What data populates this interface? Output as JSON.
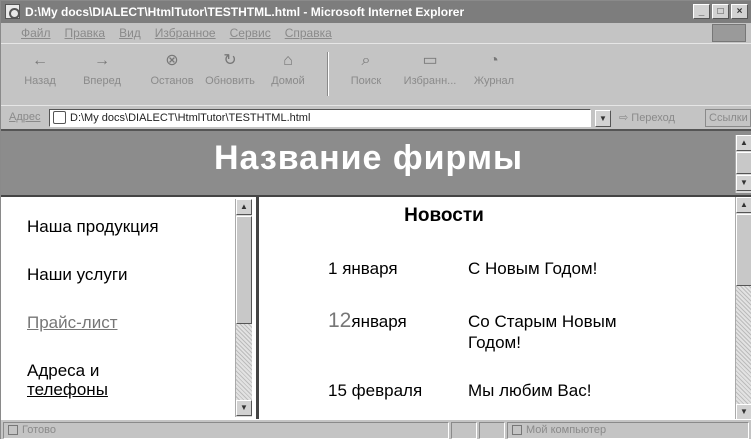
{
  "window": {
    "title": "D:\\My docs\\DIALECT\\HtmlTutor\\TESTHTML.html - Microsoft Internet Explorer",
    "controls": [
      "_",
      "□",
      "×"
    ]
  },
  "menu": [
    "Файл",
    "Правка",
    "Вид",
    "Избранное",
    "Сервис",
    "Справка"
  ],
  "toolbar": {
    "back": "Назад",
    "forward": "Вперед",
    "stop": "Останов",
    "refresh": "Обновить",
    "home": "Домой",
    "search": "Поиск",
    "favorites": "Избранн...",
    "history": "Журнал"
  },
  "address": {
    "label": "Адрес",
    "value": "D:\\My docs\\DIALECT\\HtmlTutor\\TESTHTML.html",
    "go": "Переход",
    "links": "Ссылки"
  },
  "page": {
    "firm_title": "Название фирмы",
    "nav": {
      "products": "Наша продукция",
      "services": "Наши услуги",
      "price": "Прайс-лист",
      "addresses_line1": "Адреса и",
      "addresses_line2": "телефоны"
    },
    "news": {
      "title": "Новости",
      "items": [
        {
          "day": "1",
          "month": "января",
          "text": "С Новым Годом!"
        },
        {
          "day": "12",
          "month": "января",
          "text": "Со Старым Новым Годом!"
        },
        {
          "day": "15",
          "month": "февраля",
          "text": "Мы любим Вас!"
        }
      ]
    }
  },
  "status": {
    "text": "Готово",
    "zone": "Мой компьютер"
  }
}
